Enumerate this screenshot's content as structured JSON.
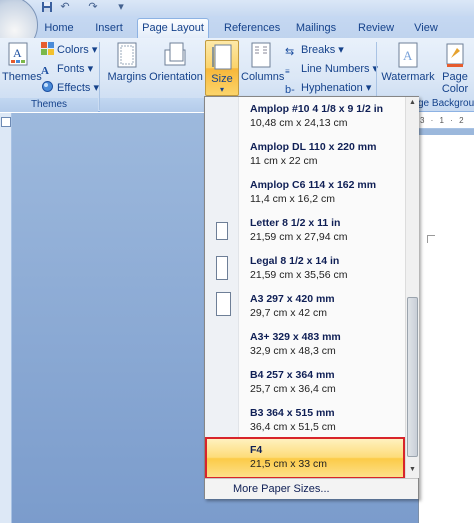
{
  "quick_access": [
    "save-icon",
    "undo-icon",
    "redo-icon",
    "customize-icon"
  ],
  "tabs": [
    {
      "label": "Home",
      "active": false
    },
    {
      "label": "Insert",
      "active": false
    },
    {
      "label": "Page Layout",
      "active": true
    },
    {
      "label": "References",
      "active": false
    },
    {
      "label": "Mailings",
      "active": false
    },
    {
      "label": "Review",
      "active": false
    },
    {
      "label": "View",
      "active": false
    }
  ],
  "ribbon": {
    "themes": {
      "button": "Themes",
      "colors": "Colors",
      "fonts": "Fonts",
      "effects": "Effects",
      "group_label": "Themes"
    },
    "page_setup": {
      "margins": "Margins",
      "orientation": "Orientation",
      "size": "Size",
      "columns": "Columns",
      "breaks": "Breaks",
      "line_numbers": "Line Numbers",
      "hyphenation": "Hyphenation"
    },
    "page_background": {
      "watermark": "Watermark",
      "page_color_line1": "Page",
      "page_color_line2": "Color",
      "group_label_partial": "ge Backgrou"
    }
  },
  "ruler_partial": "3 · 1 · 2",
  "size_menu": {
    "items": [
      {
        "name": "Amplop #10 4 1/8 x 9 1/2 in",
        "dims": "10,48 cm x 24,13 cm",
        "icon": "envelope"
      },
      {
        "name": "Amplop DL 110 x 220 mm",
        "dims": "11 cm x 22 cm",
        "icon": "envelope"
      },
      {
        "name": "Amplop C6 114 x 162 mm",
        "dims": "11,4 cm x 16,2 cm",
        "icon": "envelope"
      },
      {
        "name": "Letter 8 1/2 x 11 in",
        "dims": "21,59 cm x 27,94 cm",
        "icon": "page"
      },
      {
        "name": "Legal 8 1/2 x 14 in",
        "dims": "21,59 cm x 35,56 cm",
        "icon": "page"
      },
      {
        "name": "A3 297 x 420 mm",
        "dims": "29,7 cm x 42 cm",
        "icon": "page"
      },
      {
        "name": "A3+ 329 x 483 mm",
        "dims": "32,9 cm x 48,3 cm",
        "icon": "none"
      },
      {
        "name": "B4 257 x 364 mm",
        "dims": "25,7 cm x 36,4 cm",
        "icon": "none"
      },
      {
        "name": "B3 364 x 515 mm",
        "dims": "36,4 cm x 51,5 cm",
        "icon": "none"
      },
      {
        "name": "F4",
        "dims": "21,5 cm x 33 cm",
        "icon": "none",
        "selected": true
      }
    ],
    "more": "More Paper Sizes...",
    "highlight_color": "#d8242a"
  }
}
